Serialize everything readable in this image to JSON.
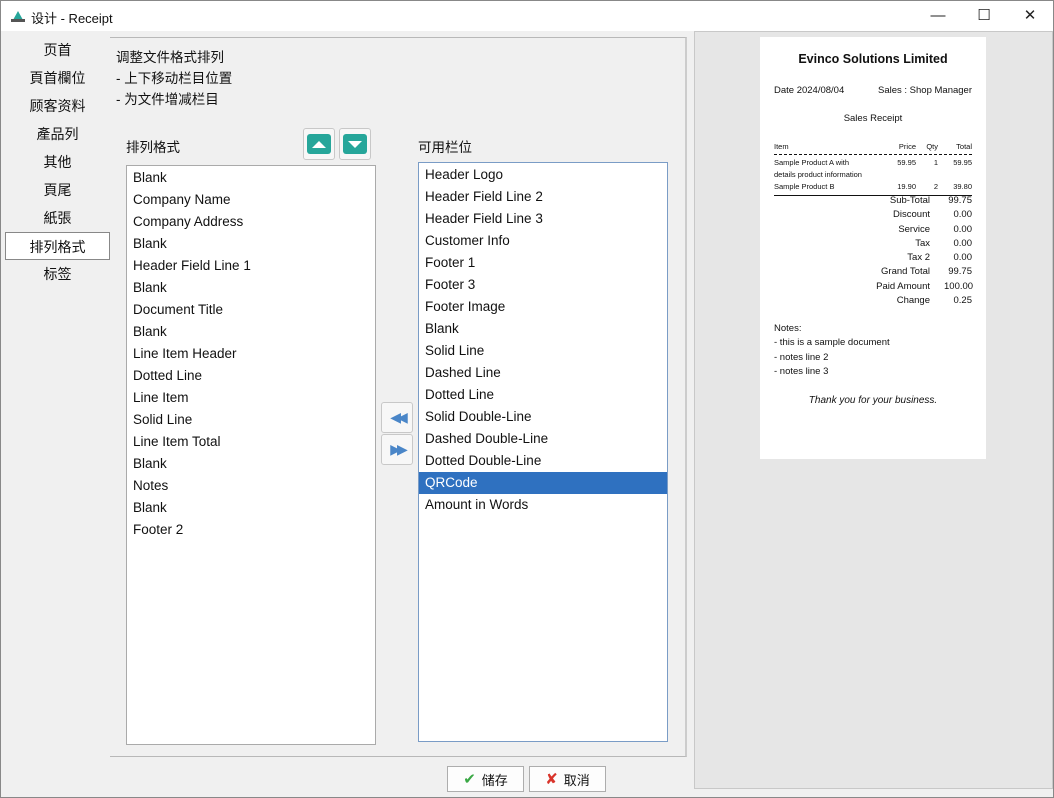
{
  "window": {
    "title": "设计 - Receipt",
    "minimize": "—",
    "maximize": "☐",
    "close": "✕"
  },
  "sidebar": {
    "items": [
      {
        "label": "页首"
      },
      {
        "label": "頁首欄位"
      },
      {
        "label": "顾客资料"
      },
      {
        "label": "產品列"
      },
      {
        "label": "其他"
      },
      {
        "label": "頁尾"
      },
      {
        "label": "紙張"
      },
      {
        "label": "排列格式",
        "active": true
      },
      {
        "label": "标签"
      }
    ]
  },
  "main": {
    "intro": [
      "调整文件格式排列",
      "- 上下移动栏目位置",
      "- 为文件增减栏目"
    ],
    "layout_label": "排列格式",
    "available_label": "可用栏位",
    "layout_items": [
      "Blank",
      "Company Name",
      "Company Address",
      "Blank",
      "Header Field Line 1",
      "Blank",
      "Document Title",
      "Blank",
      "Line Item Header",
      "Dotted Line",
      "Line Item",
      "Solid Line",
      "Line Item Total",
      "Blank",
      "Notes",
      "Blank",
      "Footer 2"
    ],
    "available_items": [
      "Header Logo",
      "Header Field Line 2",
      "Header Field Line 3",
      "Customer Info",
      "Footer 1",
      "Footer 3",
      "Footer Image",
      "Blank",
      "Solid Line",
      "Dashed Line",
      "Dotted Line",
      "Solid Double-Line",
      "Dashed Double-Line",
      "Dotted Double-Line",
      "QRCode",
      "Amount in Words"
    ],
    "available_selected": "QRCode",
    "accent": "#26a69a",
    "selection_color": "#2f71c0"
  },
  "preview": {
    "company": "Evinco Solutions Limited",
    "date": "Date 2024/08/04",
    "sales": "Sales : Shop Manager",
    "doc_title": "Sales Receipt",
    "headers": [
      "Item",
      "Price",
      "Qty",
      "Total"
    ],
    "lines": [
      [
        "Sample Product A with",
        "59.95",
        "1",
        "59.95"
      ],
      [
        "details product information",
        "",
        "",
        ""
      ],
      [
        "Sample Product B",
        "19.90",
        "2",
        "39.80"
      ]
    ],
    "totals": [
      [
        "Sub-Total",
        "99.75"
      ],
      [
        "Discount",
        "0.00"
      ],
      [
        "Service",
        "0.00"
      ],
      [
        "Tax",
        "0.00"
      ],
      [
        "Tax 2",
        "0.00"
      ],
      [
        "Grand Total",
        "99.75"
      ],
      [
        "Paid Amount",
        "100.00"
      ],
      [
        "Change",
        "0.25"
      ]
    ],
    "notes": [
      "Notes:",
      "- this is a sample document",
      "- notes line 2",
      "- notes line 3"
    ],
    "thanks": "Thank you for your business."
  },
  "footer": {
    "save": "储存",
    "cancel": "取消"
  }
}
